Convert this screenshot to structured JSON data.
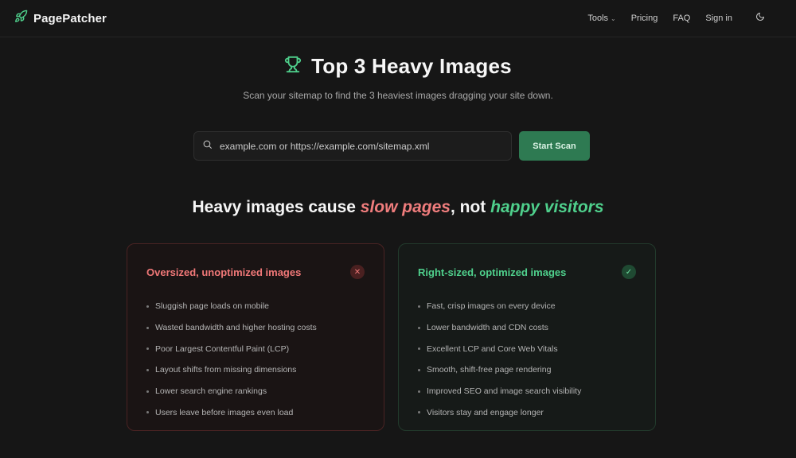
{
  "header": {
    "brand": "PagePatcher",
    "nav": [
      {
        "label": "Tools",
        "has_dropdown": true
      },
      {
        "label": "Pricing"
      },
      {
        "label": "FAQ"
      },
      {
        "label": "Sign in"
      }
    ],
    "theme_icon": "moon-icon"
  },
  "hero": {
    "icon": "trophy-icon",
    "title": "Top 3 Heavy Images",
    "subtitle": "Scan your sitemap to find the 3 heaviest images dragging your site down."
  },
  "search": {
    "icon": "search-icon",
    "placeholder": "example.com or https://example.com/sitemap.xml",
    "value": "",
    "button_label": "Start Scan"
  },
  "section": {
    "prefix": "Heavy images cause ",
    "bad_phrase": "slow pages",
    "middle": ", not ",
    "good_phrase": "happy visitors"
  },
  "cards": {
    "bad": {
      "title": "Oversized, unoptimized images",
      "icon": "x-icon",
      "items": [
        "Sluggish page loads on mobile",
        "Wasted bandwidth and higher hosting costs",
        "Poor Largest Contentful Paint (LCP)",
        "Layout shifts from missing dimensions",
        "Lower search engine rankings",
        "Users leave before images even load"
      ]
    },
    "good": {
      "title": "Right-sized, optimized images",
      "icon": "check-icon",
      "items": [
        "Fast, crisp images on every device",
        "Lower bandwidth and CDN costs",
        "Excellent LCP and Core Web Vitals",
        "Smooth, shift-free page rendering",
        "Improved SEO and image search visibility",
        "Visitors stay and engage longer"
      ]
    }
  },
  "colors": {
    "background": "#161616",
    "accent_green": "#4fd08c",
    "accent_red": "#f07878",
    "button_green": "#2e7a52"
  }
}
